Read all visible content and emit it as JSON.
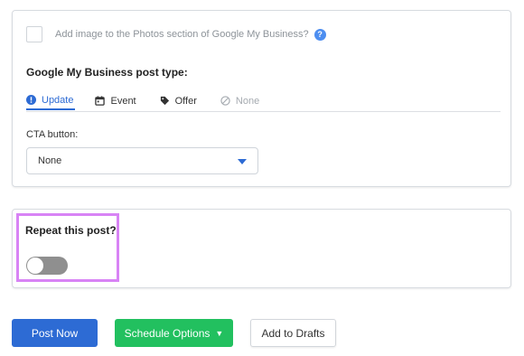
{
  "photos": {
    "label": "Add image to the Photos section of Google My Business?",
    "help_icon": "question-circle-icon",
    "checked": false
  },
  "post_type": {
    "title": "Google My Business post type:",
    "tabs": [
      {
        "label": "Update",
        "icon": "info-circle-icon",
        "state": "active"
      },
      {
        "label": "Event",
        "icon": "calendar-icon",
        "state": "normal"
      },
      {
        "label": "Offer",
        "icon": "tag-icon",
        "state": "normal"
      },
      {
        "label": "None",
        "icon": "ban-icon",
        "state": "disabled"
      }
    ]
  },
  "cta": {
    "label": "CTA button:",
    "selected": "None"
  },
  "repeat": {
    "label": "Repeat this post?",
    "enabled": false
  },
  "actions": {
    "post_now": "Post Now",
    "schedule": "Schedule Options",
    "drafts": "Add to Drafts"
  },
  "colors": {
    "primary": "#2d6bd4",
    "success": "#22c05f",
    "highlight": "#d883f5"
  }
}
